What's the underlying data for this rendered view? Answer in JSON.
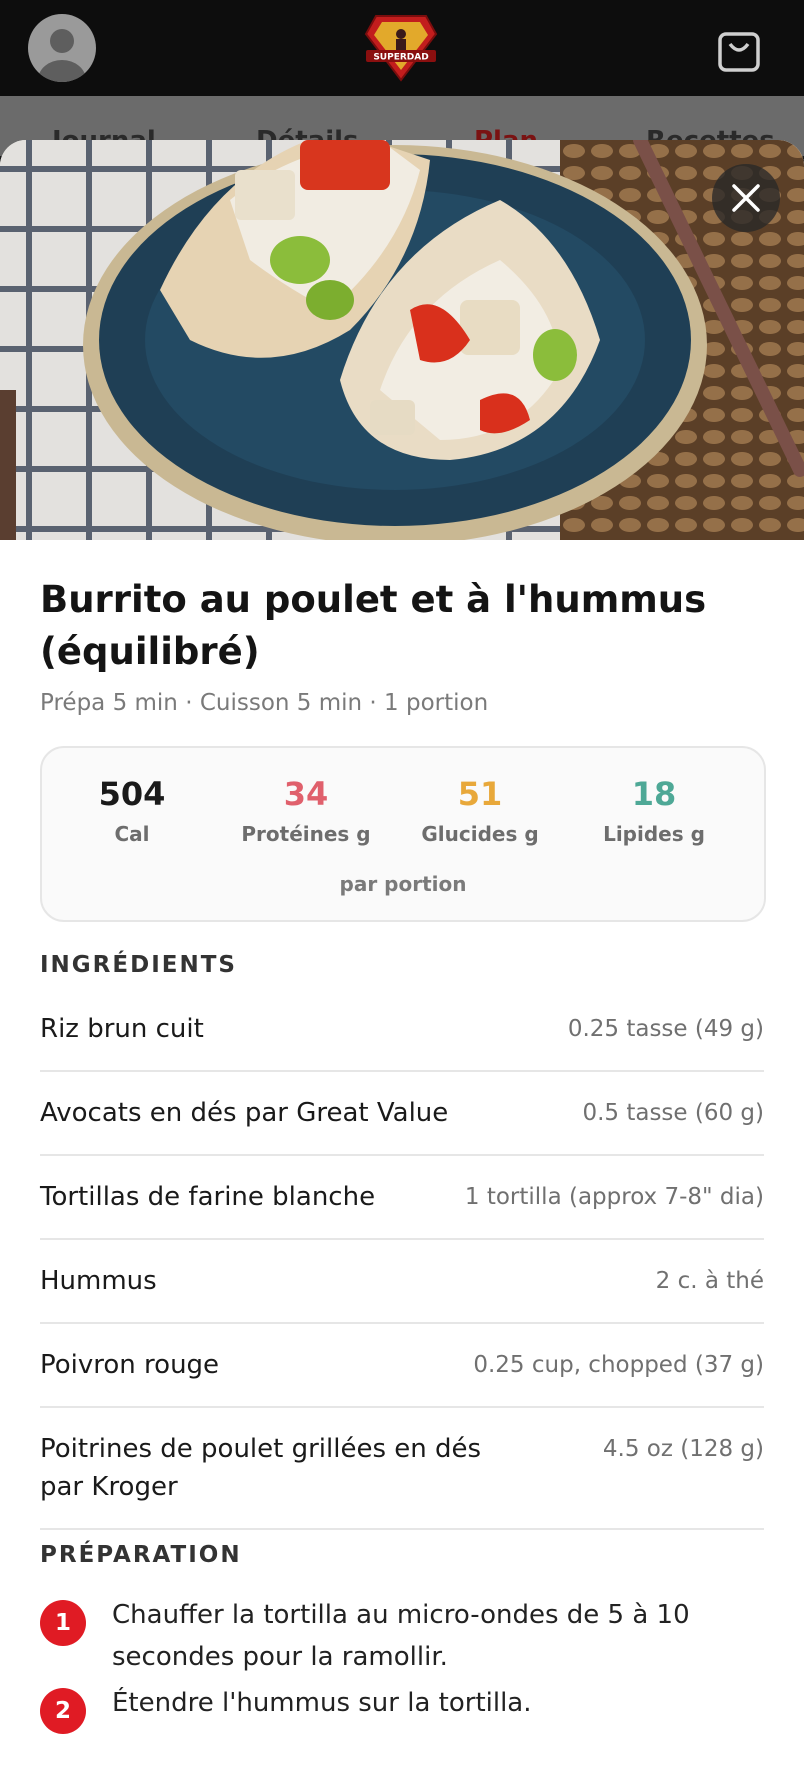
{
  "header": {
    "logo_text": "SUPERDAD",
    "icons": {
      "avatar": "user-avatar-icon",
      "logo": "superdad-logo",
      "cart": "shopping-bag-icon"
    }
  },
  "tabs": [
    {
      "label": "Journal",
      "active": false
    },
    {
      "label": "Détails",
      "active": false
    },
    {
      "label": "Plan",
      "active": true
    },
    {
      "label": "Recettes",
      "active": false
    }
  ],
  "recipe": {
    "title": "Burrito au poulet et à l'hummus (équilibré)",
    "meta": "Prépa 5 min · Cuisson 5 min · 1 portion",
    "macros": [
      {
        "value": "504",
        "label": "Cal",
        "color": "#1a1a1a"
      },
      {
        "value": "34",
        "label": "Protéines g",
        "color": "#e0606c"
      },
      {
        "value": "51",
        "label": "Glucides g",
        "color": "#e8a83a"
      },
      {
        "value": "18",
        "label": "Lipides g",
        "color": "#4ea896"
      }
    ],
    "per_serving": "par portion",
    "ingredients_title": "INGRÉDIENTS",
    "ingredients": [
      {
        "name": "Riz brun cuit",
        "qty": "0.25 tasse (49 g)"
      },
      {
        "name": "Avocats en dés par Great Value",
        "qty": "0.5 tasse (60 g)"
      },
      {
        "name": "Tortillas de farine blanche",
        "qty": "1 tortilla (approx 7-8\" dia)"
      },
      {
        "name": "Hummus",
        "qty": "2 c. à thé"
      },
      {
        "name": "Poivron rouge",
        "qty": "0.25 cup, chopped (37 g)"
      },
      {
        "name": "Poitrines de poulet grillées en dés par Kroger",
        "qty": "4.5 oz (128 g)"
      }
    ],
    "preparation_title": "PRÉPARATION",
    "steps": [
      {
        "num": "1",
        "text": "Chauffer la tortilla au micro-ondes de 5 à 10 secondes pour la ramollir."
      },
      {
        "num": "2",
        "text": "Étendre l'hummus sur la tortilla."
      }
    ]
  },
  "colors": {
    "accent": "#e01b24",
    "header_bg": "#0d0d0d"
  }
}
